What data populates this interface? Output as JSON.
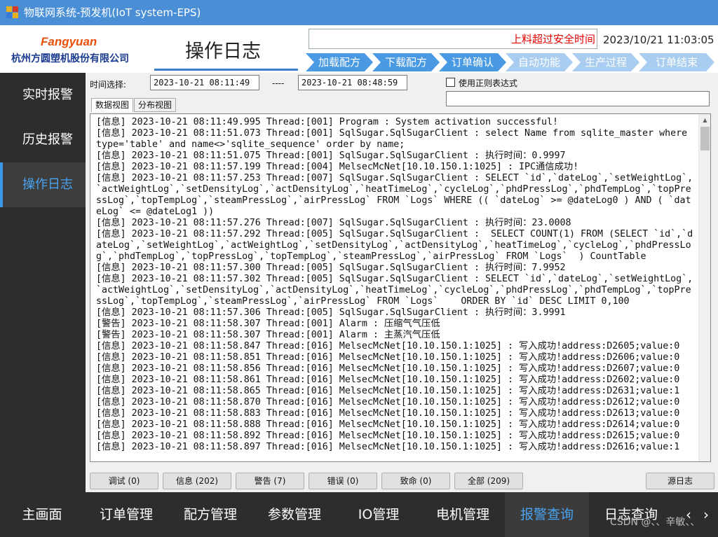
{
  "window": {
    "title": "物联网系统-预发机(IoT system-EPS)"
  },
  "header": {
    "logo_en": "Fangyuan",
    "logo_cn": "杭州方圆塑机股份有限公司",
    "page_title": "操作日志",
    "alarm_text": "上料超过安全时间",
    "datetime": "2023/10/21 11:03:05",
    "steps": [
      "加载配方",
      "下载配方",
      "订单确认",
      "自动功能",
      "生产过程",
      "订单结束"
    ]
  },
  "sidebar": {
    "items": [
      {
        "label": "实时报警",
        "active": false
      },
      {
        "label": "历史报警",
        "active": false
      },
      {
        "label": "操作日志",
        "active": true
      }
    ]
  },
  "filters": {
    "time_label": "时间选择:",
    "start_time": "2023-10-21 08:11:49",
    "separator": "----",
    "end_time": "2023-10-21 08:48:59",
    "regex_label": "使用正则表达式",
    "regex_checked": false,
    "regex_value": ""
  },
  "tabs": [
    {
      "label": "数据视图",
      "active": true
    },
    {
      "label": "分布视图",
      "active": false
    }
  ],
  "log": {
    "lines": [
      "[信息] 2023-10-21 08:11:49.995 Thread:[001] Program : System activation successful!",
      "[信息] 2023-10-21 08:11:51.073 Thread:[001] SqlSugar.SqlSugarClient : select Name from sqlite_master where type='table' and name<>'sqlite_sequence' order by name;",
      "[信息] 2023-10-21 08:11:51.075 Thread:[001] SqlSugar.SqlSugarClient : 执行时间：0.9997",
      "[信息] 2023-10-21 08:11:57.199 Thread:[004] MelsecMcNet[10.10.150.1:1025] : IPC通信成功!",
      "[信息] 2023-10-21 08:11:57.253 Thread:[007] SqlSugar.SqlSugarClient : SELECT `id`,`dateLog`,`setWeightLog`,`actWeightLog`,`setDensityLog`,`actDensityLog`,`heatTimeLog`,`cycleLog`,`phdPressLog`,`phdTempLog`,`topPressLog`,`topTempLog`,`steamPressLog`,`airPressLog` FROM `Logs` WHERE (( `dateLog` >= @dateLog0 ) AND ( `dateLog` <= @dateLog1 ))",
      "[信息] 2023-10-21 08:11:57.276 Thread:[007] SqlSugar.SqlSugarClient : 执行时间：23.0008",
      "[信息] 2023-10-21 08:11:57.292 Thread:[005] SqlSugar.SqlSugarClient :  SELECT COUNT(1) FROM (SELECT `id`,`dateLog`,`setWeightLog`,`actWeightLog`,`setDensityLog`,`actDensityLog`,`heatTimeLog`,`cycleLog`,`phdPressLog`,`phdTempLog`,`topPressLog`,`topTempLog`,`steamPressLog`,`airPressLog` FROM `Logs`  ) CountTable",
      "[信息] 2023-10-21 08:11:57.300 Thread:[005] SqlSugar.SqlSugarClient : 执行时间：7.9952",
      "[信息] 2023-10-21 08:11:57.302 Thread:[005] SqlSugar.SqlSugarClient : SELECT `id`,`dateLog`,`setWeightLog`,`actWeightLog`,`setDensityLog`,`actDensityLog`,`heatTimeLog`,`cycleLog`,`phdPressLog`,`phdTempLog`,`topPressLog`,`topTempLog`,`steamPressLog`,`airPressLog` FROM `Logs`    ORDER BY `id` DESC LIMIT 0,100",
      "[信息] 2023-10-21 08:11:57.306 Thread:[005] SqlSugar.SqlSugarClient : 执行时间：3.9991",
      "[警告] 2023-10-21 08:11:58.307 Thread:[001] Alarm : 压缩气气压低",
      "[警告] 2023-10-21 08:11:58.307 Thread:[001] Alarm : 主蒸汽气压低",
      "[信息] 2023-10-21 08:11:58.847 Thread:[016] MelsecMcNet[10.10.150.1:1025] : 写入成功!address:D2605;value:0",
      "[信息] 2023-10-21 08:11:58.851 Thread:[016] MelsecMcNet[10.10.150.1:1025] : 写入成功!address:D2606;value:0",
      "[信息] 2023-10-21 08:11:58.856 Thread:[016] MelsecMcNet[10.10.150.1:1025] : 写入成功!address:D2607;value:0",
      "[信息] 2023-10-21 08:11:58.861 Thread:[016] MelsecMcNet[10.10.150.1:1025] : 写入成功!address:D2602;value:0",
      "[信息] 2023-10-21 08:11:58.865 Thread:[016] MelsecMcNet[10.10.150.1:1025] : 写入成功!address:D2631;value:1",
      "[信息] 2023-10-21 08:11:58.870 Thread:[016] MelsecMcNet[10.10.150.1:1025] : 写入成功!address:D2612;value:0",
      "[信息] 2023-10-21 08:11:58.883 Thread:[016] MelsecMcNet[10.10.150.1:1025] : 写入成功!address:D2613;value:0",
      "[信息] 2023-10-21 08:11:58.888 Thread:[016] MelsecMcNet[10.10.150.1:1025] : 写入成功!address:D2614;value:0",
      "[信息] 2023-10-21 08:11:58.892 Thread:[016] MelsecMcNet[10.10.150.1:1025] : 写入成功!address:D2615;value:0",
      "[信息] 2023-10-21 08:11:58.897 Thread:[016] MelsecMcNet[10.10.150.1:1025] : 写入成功!address:D2616;value:1"
    ]
  },
  "buttons": {
    "debug": "调试 (0)",
    "info": "信息 (202)",
    "warn": "警告 (7)",
    "error": "错误 (0)",
    "fatal": "致命 (0)",
    "all": "全部 (209)",
    "source": "源日志"
  },
  "bottom_nav": {
    "items": [
      {
        "label": "主画面",
        "active": false
      },
      {
        "label": "订单管理",
        "active": false
      },
      {
        "label": "配方管理",
        "active": false
      },
      {
        "label": "参数管理",
        "active": false
      },
      {
        "label": "IO管理",
        "active": false
      },
      {
        "label": "电机管理",
        "active": false
      },
      {
        "label": "报警查询",
        "active": true
      },
      {
        "label": "日志查询",
        "active": false
      }
    ],
    "prev_arrow": "‹",
    "next_arrow": "›"
  },
  "watermark": "CSDN @、、辛敏、、",
  "colors": {
    "step_done": "#4a9ae3",
    "step_todo": "#a9cdf0",
    "accent": "#4aa3f0",
    "alarm": "#e60000"
  }
}
